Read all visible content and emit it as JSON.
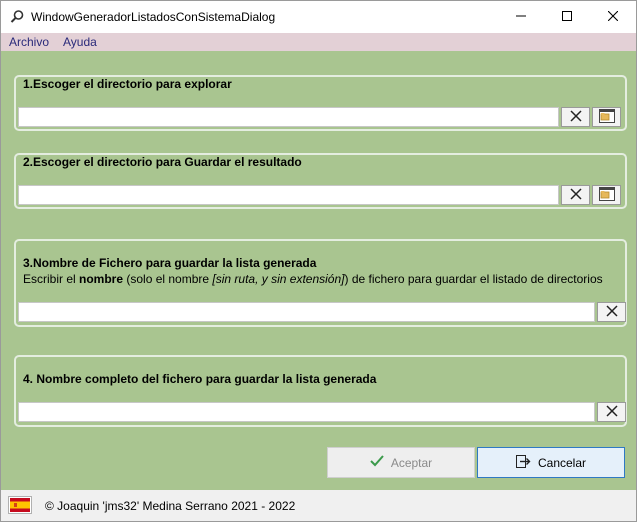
{
  "window": {
    "title": "WindowGeneradorListadosConSistemaDialog"
  },
  "menu": {
    "archivo": "Archivo",
    "ayuda": "Ayuda"
  },
  "group1": {
    "title": "1.Escoger el directorio para explorar",
    "value": ""
  },
  "group2": {
    "title": "2.Escoger el directorio para Guardar el resultado",
    "value": ""
  },
  "group3": {
    "title": "3.Nombre de Fichero para guardar la lista generada",
    "desc_prefix": "Escribir el ",
    "desc_bold": "nombre",
    "desc_middle": " (solo el nombre ",
    "desc_italic": "[sin ruta, y sin extensión]",
    "desc_suffix": ") de fichero para guardar el listado de directorios",
    "value": ""
  },
  "group4": {
    "title": "4. Nombre completo del fichero para guardar la lista generada",
    "value": ""
  },
  "buttons": {
    "aceptar": "Aceptar",
    "cancelar": "Cancelar"
  },
  "status": {
    "text": "© Joaquin 'jms32' Medina Serrano 2021 - 2022",
    "flag_icon": "spain-flag-icon"
  },
  "colors": {
    "background": "#a9c590",
    "menubar": "#e3d0d6",
    "accept_check": "#3b9a4b",
    "cancel_border": "#2f79c4"
  }
}
